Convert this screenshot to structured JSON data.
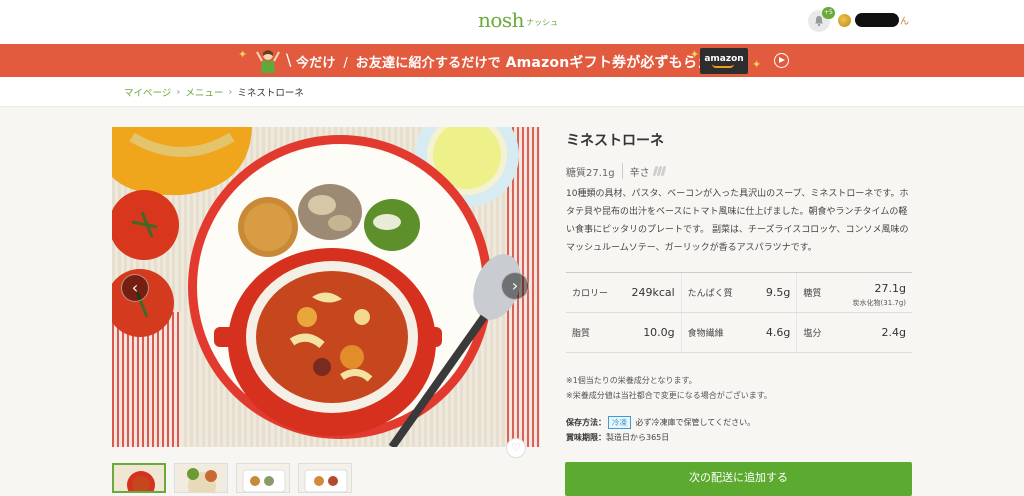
{
  "header": {
    "logo": "nosh",
    "logo_sub": "ナッシュ",
    "notification_count": "+5",
    "user_suffix": "ん"
  },
  "banner": {
    "text_pre": "今だけ",
    "text_main": "お友達に紹介するだけで",
    "text_em": "Amazonギフト券が必ずもらえる！",
    "card_label": "amazon"
  },
  "breadcrumb": {
    "items": [
      "マイページ",
      "メニュー"
    ],
    "current": "ミネストローネ"
  },
  "product": {
    "name": "ミネストローネ",
    "sugar_label": "糖質27.1g",
    "spice_label": "辛さ",
    "description": "10種類の具材、パスタ、ベーコンが入った具沢山のスープ、ミネストローネです。ホタテ貝や昆布の出汁をベースにトマト風味に仕上げました。朝食やランチタイムの軽い食事にピッタリのプレートです。 副菜は、チーズライスコロッケ、コンソメ風味のマッシュルームソテー、ガーリックが香るアスパラツナです。",
    "nutrition": [
      [
        {
          "label": "カロリー",
          "value": "249kcal"
        },
        {
          "label": "たんぱく質",
          "value": "9.5g"
        },
        {
          "label": "糖質",
          "value": "27.1g",
          "sub": "炭水化物(31.7g)"
        }
      ],
      [
        {
          "label": "脂質",
          "value": "10.0g"
        },
        {
          "label": "食物繊維",
          "value": "4.6g"
        },
        {
          "label": "塩分",
          "value": "2.4g"
        }
      ]
    ],
    "notes": [
      "※1個当たりの栄養成分となります。",
      "※栄養成分値は当社都合で変更になる場合がございます。"
    ],
    "storage_label": "保存方法：",
    "storage_badge": "冷凍",
    "storage_text": "必ず冷凍庫で保管してください。",
    "expiry_label": "賞味期限：",
    "expiry_text": "製造日から365日"
  },
  "actions": {
    "add_label": "次の配送に追加する"
  },
  "icons": {
    "prev": "chevron-left-icon",
    "next": "chevron-right-icon",
    "favorite": "heart-icon",
    "bell": "bell-icon",
    "play": "play-icon"
  },
  "colors": {
    "brand_green": "#6aaa3a",
    "banner_red": "#e25b3e",
    "button_green": "#5cab30"
  }
}
